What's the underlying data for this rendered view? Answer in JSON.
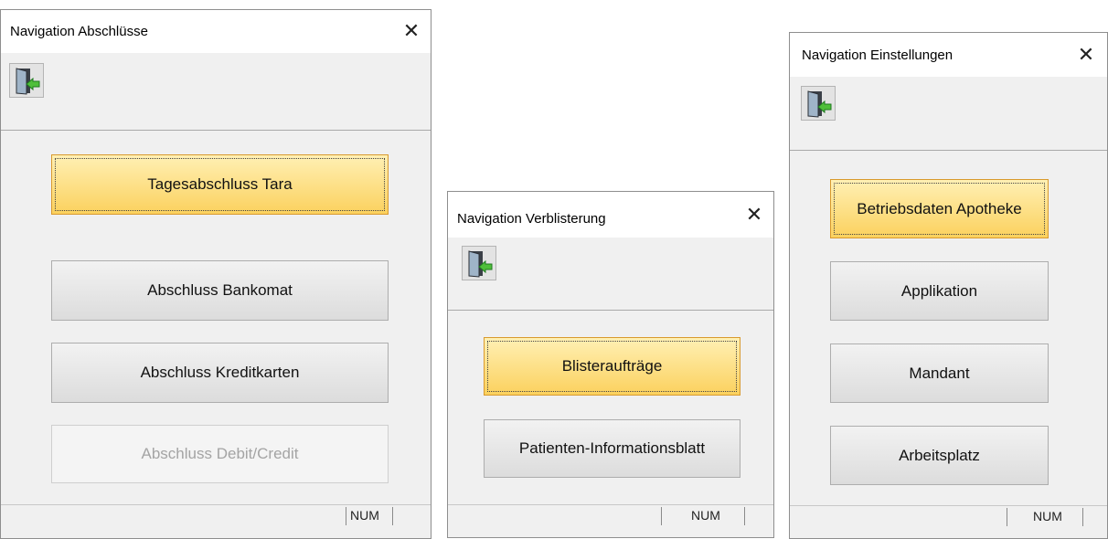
{
  "icons": {
    "close": "close-icon",
    "exit": "exit-door-icon"
  },
  "colors": {
    "active_button": "#fbd15e",
    "button": "#dcdcdc",
    "disabled_text": "#a4a4a4"
  },
  "windows": {
    "abschluesse": {
      "title": "Navigation Abschlüsse",
      "close_glyph": "✕",
      "buttons": [
        {
          "label": "Tagesabschluss Tara",
          "state": "focused"
        },
        {
          "label": "Abschluss Bankomat",
          "state": "normal"
        },
        {
          "label": "Abschluss Kreditkarten",
          "state": "normal"
        },
        {
          "label": "Abschluss Debit/Credit",
          "state": "disabled"
        }
      ],
      "status": {
        "num": "NUM"
      }
    },
    "verblisterung": {
      "title": "Navigation Verblisterung",
      "close_glyph": "✕",
      "buttons": [
        {
          "label": "Blisteraufträge",
          "state": "focused"
        },
        {
          "label": "Patienten-Informationsblatt",
          "state": "normal"
        }
      ],
      "status": {
        "num": "NUM"
      }
    },
    "einstellungen": {
      "title": "Navigation Einstellungen",
      "close_glyph": "✕",
      "buttons": [
        {
          "label": "Betriebsdaten Apotheke",
          "state": "focused"
        },
        {
          "label": "Applikation",
          "state": "normal"
        },
        {
          "label": "Mandant",
          "state": "normal"
        },
        {
          "label": "Arbeitsplatz",
          "state": "normal"
        }
      ],
      "status": {
        "num": "NUM"
      }
    }
  }
}
